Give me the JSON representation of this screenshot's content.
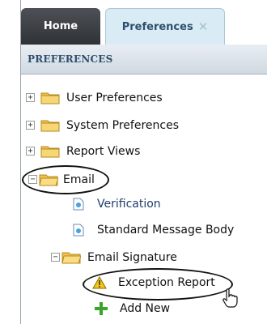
{
  "tabs": {
    "home_label": "Home",
    "preferences_label": "Preferences",
    "close_glyph": "✕"
  },
  "panel": {
    "header": "PREFERENCES"
  },
  "tree": {
    "user_preferences": "User Preferences",
    "system_preferences": "System Preferences",
    "report_views": "Report Views",
    "email": "Email",
    "verification": "Verification",
    "standard_message_body": "Standard Message Body",
    "email_signature": "Email Signature",
    "exception_report": "Exception Report",
    "add_new": "Add New"
  },
  "glyphs": {
    "expand": "+",
    "collapse": "−"
  },
  "colors": {
    "folder": "#f2c24b",
    "selected_text": "#1f3d6b",
    "add_icon": "#3aa52a",
    "warning": "#f5c518"
  },
  "icons": [
    "folder-icon",
    "document-icon",
    "warning-icon",
    "plus-icon",
    "hand-cursor-icon"
  ]
}
